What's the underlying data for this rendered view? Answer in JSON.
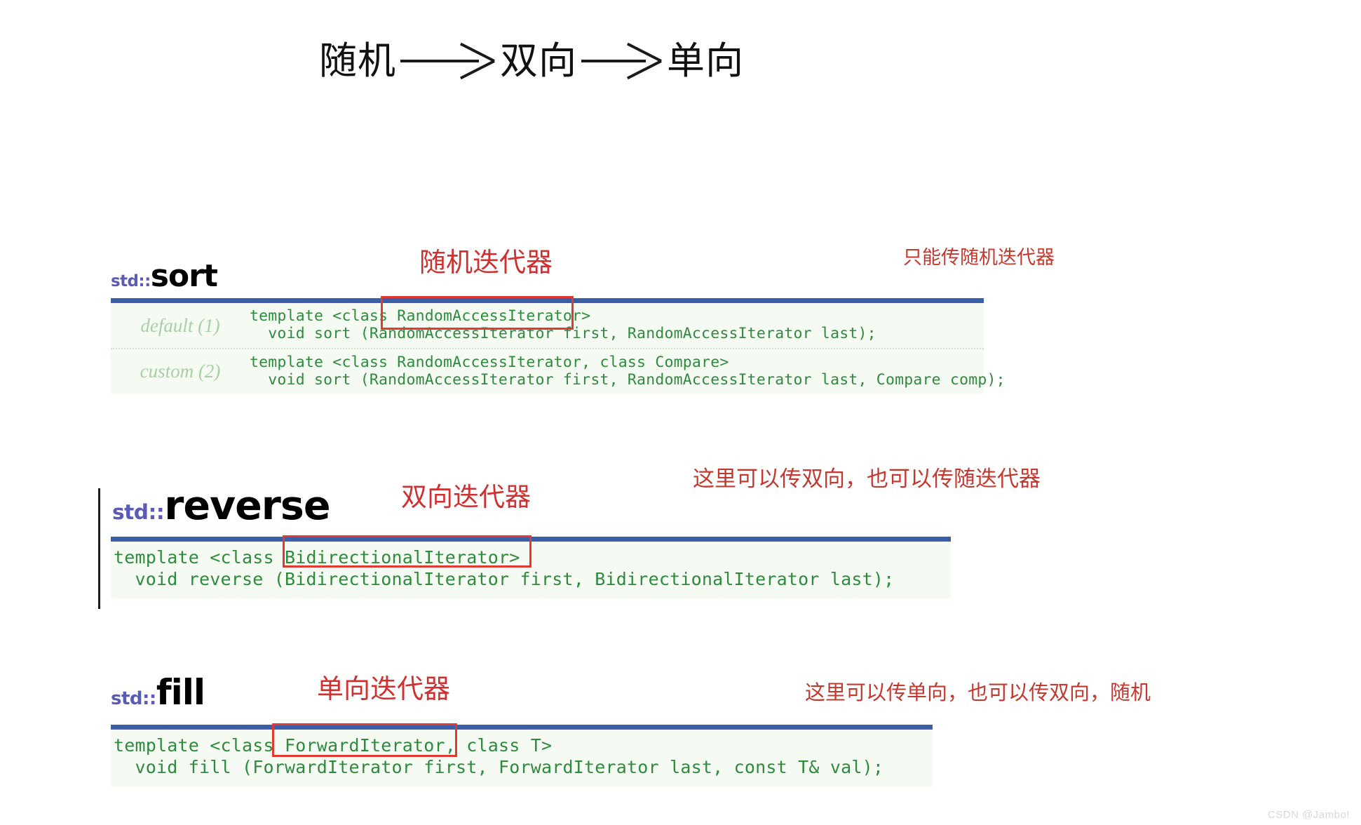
{
  "header": {
    "terms": [
      "随机",
      "双向",
      "单向"
    ],
    "arrow_symbol": "arrow-right"
  },
  "sections": [
    {
      "id": "sort",
      "namespace": "std::",
      "name": "sort",
      "iterator_label": "随机迭代器",
      "note": "只能传随机迭代器",
      "highlight": "RandomAccessIterator",
      "rows": [
        {
          "variant": "default (1)",
          "line1": "template <class RandomAccessIterator>",
          "line2": "  void sort (RandomAccessIterator first, RandomAccessIterator last);"
        },
        {
          "variant": "custom (2)",
          "line1": "template <class RandomAccessIterator, class Compare>",
          "line2": "  void sort (RandomAccessIterator first, RandomAccessIterator last, Compare comp);"
        }
      ]
    },
    {
      "id": "reverse",
      "namespace": "std::",
      "name": "reverse",
      "iterator_label": "双向迭代器",
      "note": "这里可以传双向，也可以传随迭代器",
      "highlight": "BidirectionalIterator",
      "code": "template <class BidirectionalIterator>\n  void reverse (BidirectionalIterator first, BidirectionalIterator last);"
    },
    {
      "id": "fill",
      "namespace": "std::",
      "name": "fill",
      "iterator_label": "单向迭代器",
      "note": "这里可以传单向，也可以传双向，随机",
      "highlight": "ForwardIterator,",
      "code": "template <class ForwardIterator, class T>\n  void fill (ForwardIterator first, ForwardIterator last, const T& val);"
    }
  ],
  "watermark": "CSDN @Jambo!",
  "colors": {
    "namespace": "#5b5bb5",
    "code_green": "#2e8b3d",
    "variant_green": "#a8cfa3",
    "panel_bg": "#f5fbf3",
    "rule_blue": "#3a5ea8",
    "annot_red": "#cf3030",
    "box_red": "#e03a32"
  }
}
